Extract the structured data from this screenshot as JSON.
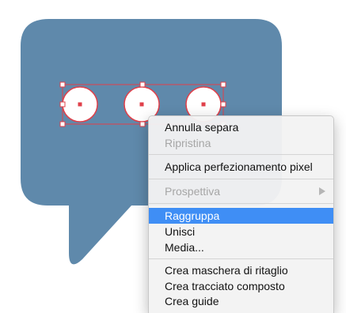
{
  "colors": {
    "bubble": "#5f89ab",
    "selection": "#e0404a",
    "menu_highlight": "#3f8ef5"
  },
  "artwork": {
    "shape": "speech-bubble",
    "dots": 3
  },
  "context_menu": {
    "groups": [
      [
        {
          "label": "Annulla separa",
          "enabled": true
        },
        {
          "label": "Ripristina",
          "enabled": false
        }
      ],
      [
        {
          "label": "Applica perfezionamento pixel",
          "enabled": true
        }
      ],
      [
        {
          "label": "Prospettiva",
          "enabled": false,
          "submenu": true
        }
      ],
      [
        {
          "label": "Raggruppa",
          "enabled": true,
          "highlighted": true
        },
        {
          "label": "Unisci",
          "enabled": true
        },
        {
          "label": "Media...",
          "enabled": true
        }
      ],
      [
        {
          "label": "Crea maschera di ritaglio",
          "enabled": true
        },
        {
          "label": "Crea tracciato composto",
          "enabled": true
        },
        {
          "label": "Crea guide",
          "enabled": true
        }
      ]
    ]
  }
}
